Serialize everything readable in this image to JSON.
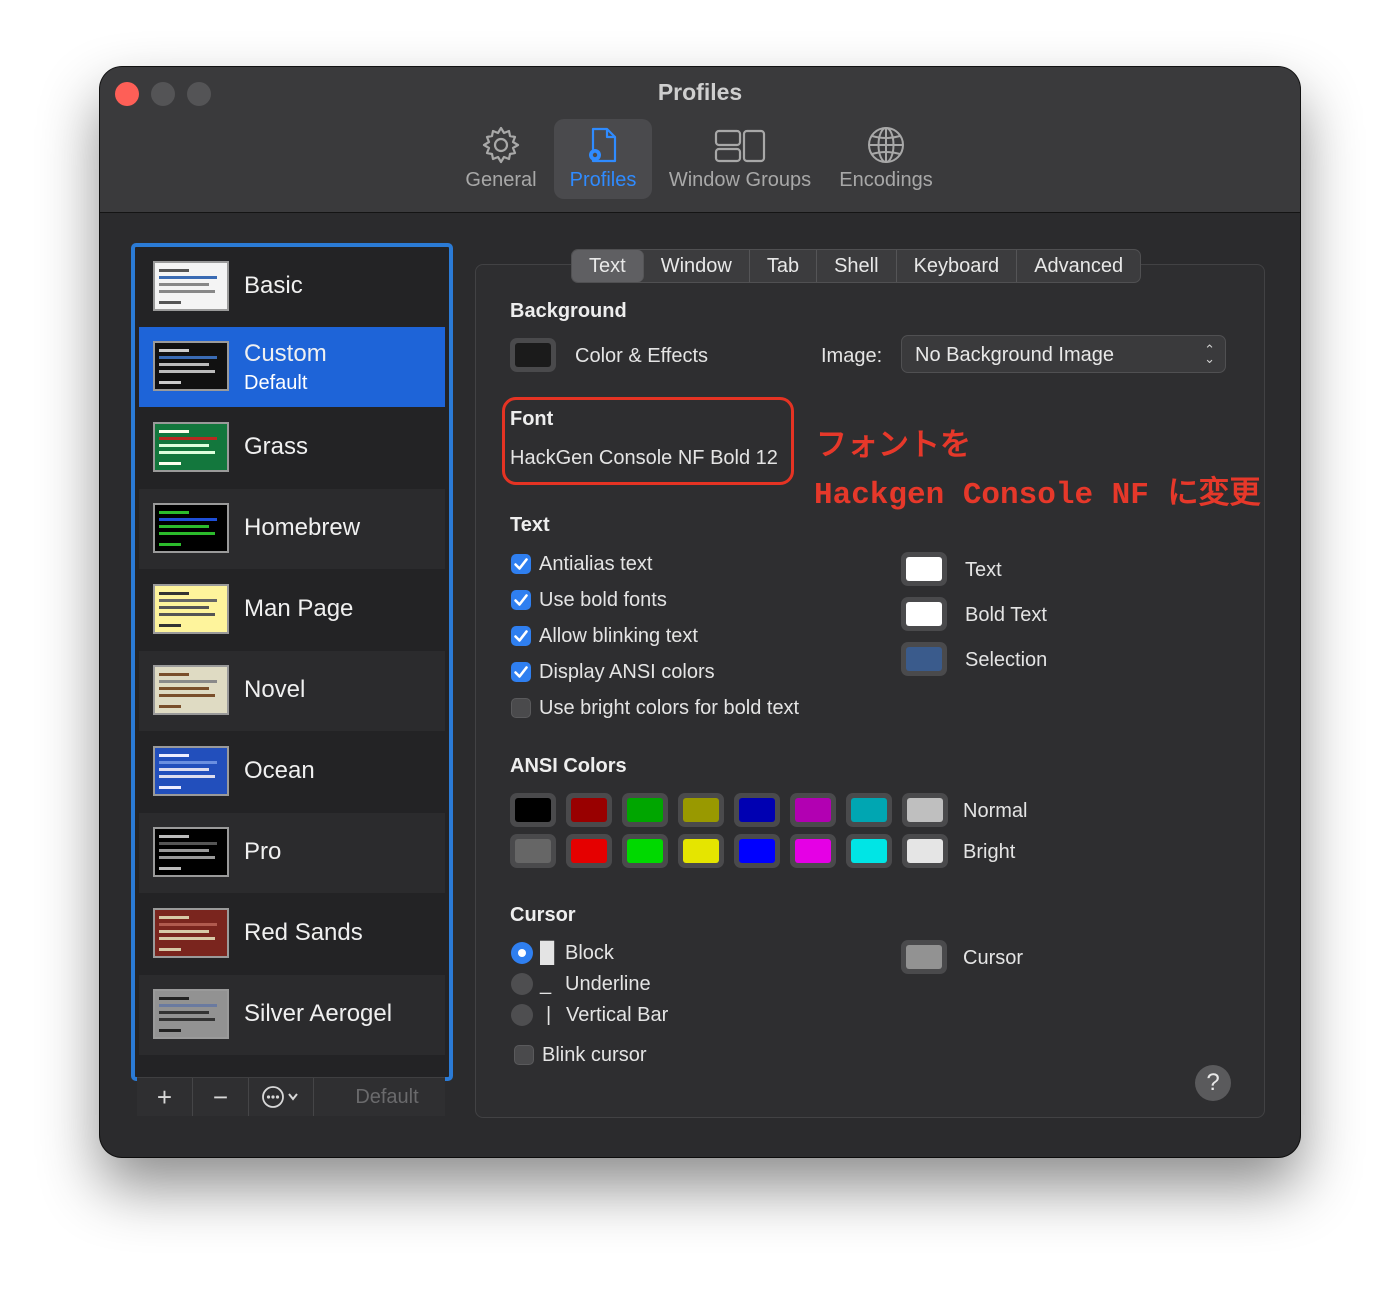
{
  "window": {
    "title": "Profiles"
  },
  "toolbar": {
    "items": [
      {
        "label": "General",
        "icon": "gear-icon"
      },
      {
        "label": "Profiles",
        "icon": "profiles-doc-icon"
      },
      {
        "label": "Window Groups",
        "icon": "window-groups-icon"
      },
      {
        "label": "Encodings",
        "icon": "globe-icon"
      }
    ],
    "active": "Profiles"
  },
  "profiles": {
    "items": [
      {
        "name": "Basic",
        "thumb_bg": "#f4f4f4"
      },
      {
        "name": "Custom",
        "subtitle": "Default",
        "thumb_bg": "#111111"
      },
      {
        "name": "Grass",
        "thumb_bg": "#13773d"
      },
      {
        "name": "Homebrew",
        "thumb_bg": "#000000"
      },
      {
        "name": "Man Page",
        "thumb_bg": "#fef49c"
      },
      {
        "name": "Novel",
        "thumb_bg": "#dfdbc3"
      },
      {
        "name": "Ocean",
        "thumb_bg": "#224fbc"
      },
      {
        "name": "Pro",
        "thumb_bg": "#000000"
      },
      {
        "name": "Red Sands",
        "thumb_bg": "#7a251e"
      },
      {
        "name": "Silver Aerogel",
        "thumb_bg": "#929292"
      }
    ],
    "selected": "Custom",
    "bottom": {
      "add": "+",
      "remove": "−",
      "more": "⋯",
      "default_label": "Default"
    }
  },
  "tabs": {
    "items": [
      "Text",
      "Window",
      "Tab",
      "Shell",
      "Keyboard",
      "Advanced"
    ],
    "active": "Text"
  },
  "background": {
    "heading": "Background",
    "color_effects_label": "Color & Effects",
    "image_label": "Image:",
    "image_value": "No Background Image"
  },
  "font": {
    "heading": "Font",
    "value": "HackGen Console NF Bold 12"
  },
  "annotation": {
    "line1": "フォントを",
    "line2": "Hackgen Console NF に変更",
    "color": "#e6382a"
  },
  "text": {
    "heading": "Text",
    "options": [
      {
        "label": "Antialias text",
        "checked": true
      },
      {
        "label": "Use bold fonts",
        "checked": true
      },
      {
        "label": "Allow blinking text",
        "checked": true
      },
      {
        "label": "Display ANSI colors",
        "checked": true
      },
      {
        "label": "Use bright colors for bold text",
        "checked": false
      }
    ],
    "colors": [
      {
        "label": "Text",
        "color": "#ffffff"
      },
      {
        "label": "Bold Text",
        "color": "#ffffff"
      },
      {
        "label": "Selection",
        "color": "#3a5b8c"
      }
    ]
  },
  "ansi": {
    "heading": "ANSI Colors",
    "normal_label": "Normal",
    "bright_label": "Bright",
    "normal": [
      "#000000",
      "#990000",
      "#00a600",
      "#999900",
      "#0000b2",
      "#b200b2",
      "#00a6b2",
      "#bfbfbf"
    ],
    "bright": [
      "#666666",
      "#e50000",
      "#00d900",
      "#e5e500",
      "#0000ff",
      "#e500e5",
      "#00e5e5",
      "#e5e5e5"
    ]
  },
  "cursor": {
    "heading": "Cursor",
    "options": [
      {
        "glyph": "█",
        "label": "Block",
        "selected": true
      },
      {
        "glyph": "_",
        "label": "Underline",
        "selected": false
      },
      {
        "glyph": "|",
        "label": "Vertical Bar",
        "selected": false
      }
    ],
    "blink_label": "Blink cursor",
    "blink": false,
    "color_label": "Cursor",
    "color": "#929292"
  },
  "help": "?"
}
